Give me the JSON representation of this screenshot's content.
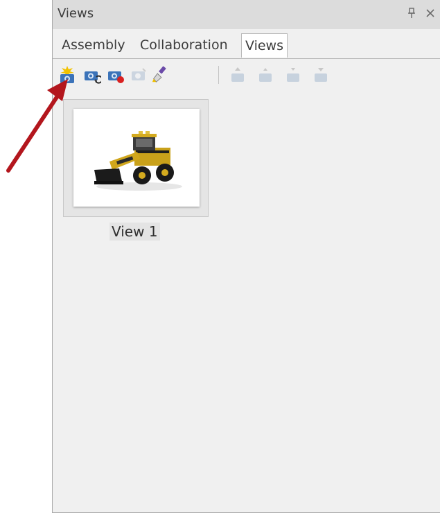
{
  "panel": {
    "title": "Views",
    "pin_icon": "pin-icon",
    "close_icon": "close-icon"
  },
  "tabs": [
    {
      "label": "Assembly",
      "active": false
    },
    {
      "label": "Collaboration",
      "active": false
    },
    {
      "label": "Views",
      "active": true
    }
  ],
  "toolbar": {
    "buttons": [
      {
        "icon": "new-view-icon",
        "enabled": true
      },
      {
        "icon": "update-view-icon",
        "enabled": true
      },
      {
        "icon": "delete-view-icon",
        "enabled": true
      },
      {
        "icon": "view-disabled-icon",
        "enabled": false
      },
      {
        "icon": "paint-brush-icon",
        "enabled": true
      },
      {
        "icon": "move-first-icon",
        "enabled": false
      },
      {
        "icon": "move-up-icon",
        "enabled": false
      },
      {
        "icon": "move-down-icon",
        "enabled": false
      },
      {
        "icon": "move-last-icon",
        "enabled": false
      }
    ]
  },
  "views": [
    {
      "label": "View 1",
      "thumbnail": "loader-model-thumbnail"
    }
  ],
  "annotation": {
    "arrow_color": "#b3161d",
    "points_to": "new-view-button"
  },
  "colors": {
    "panel_bg": "#f0f0f0",
    "titlebar_bg": "#dcdcdc",
    "active_tab_bg": "#ffffff"
  }
}
